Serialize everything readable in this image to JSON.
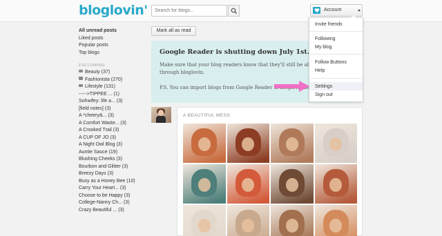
{
  "header": {
    "logo": "bloglovin'",
    "search_placeholder": "Search for blogs...",
    "account_label": "Account"
  },
  "sidebar": {
    "top_items": [
      "All unread posts",
      "Liked posts",
      "Popular posts",
      "Top blogs"
    ],
    "section_heading": "FOLLOWING",
    "folders": [
      "Beauty (37)",
      "Fashionista (270)",
      "Lifestyle (131)"
    ],
    "blogs": [
      "----->TIPPEE ... (1)",
      "Sohwifey: life a... (3)",
      "[field notes] (3)",
      "A *cheery&... (3)",
      "A Comfort Waste... (3)",
      "A Crooked Trail (3)",
      "A CUP OF JO (3)",
      "A Night Owl Blog (3)",
      "Auntie Sauce (19)",
      "Blushing Cheeks (3)",
      "Bourbon and Glitter (3)",
      "Breezy Days (3)",
      "Busy as a Honey Bee (10)",
      "Carry Your Heart... (3)",
      "Choose to be Happy (3)",
      "College-Nanny Ch... (3)",
      "Crazy Beautiful ... (3)"
    ]
  },
  "main": {
    "mark_all_read": "Mark all as read",
    "notice": {
      "title": "Google Reader is shutting down July 1st.",
      "line1": "Make sure that your blog readers know that they'll still be able to follow",
      "line2": "through bloglovin.",
      "line3": "P.S. You can import blogs from Google Reader to bloglovin here."
    },
    "post": {
      "title": "A BEAUTIFUL MESS",
      "image_tones": [
        [
          "#c86b3e",
          "#8c3d23",
          "#b07a5a",
          "#d7cfc8"
        ],
        [
          "#4e7f7a",
          "#d35a3a",
          "#6f4a35",
          "#b55a3b"
        ],
        [
          "#e2d8cc",
          "#c9a98e",
          "#a2704f",
          "#d48b5c"
        ]
      ]
    }
  },
  "account_menu": {
    "items": [
      "Invite friends",
      "Following",
      "My blog",
      "Follow Buttons",
      "Help",
      "Settings",
      "Sign out"
    ],
    "highlighted": "Settings"
  },
  "colors": {
    "brand": "#2aa9c9",
    "notice_bg": "#d9eeee",
    "arrow": "#f06fc6"
  }
}
